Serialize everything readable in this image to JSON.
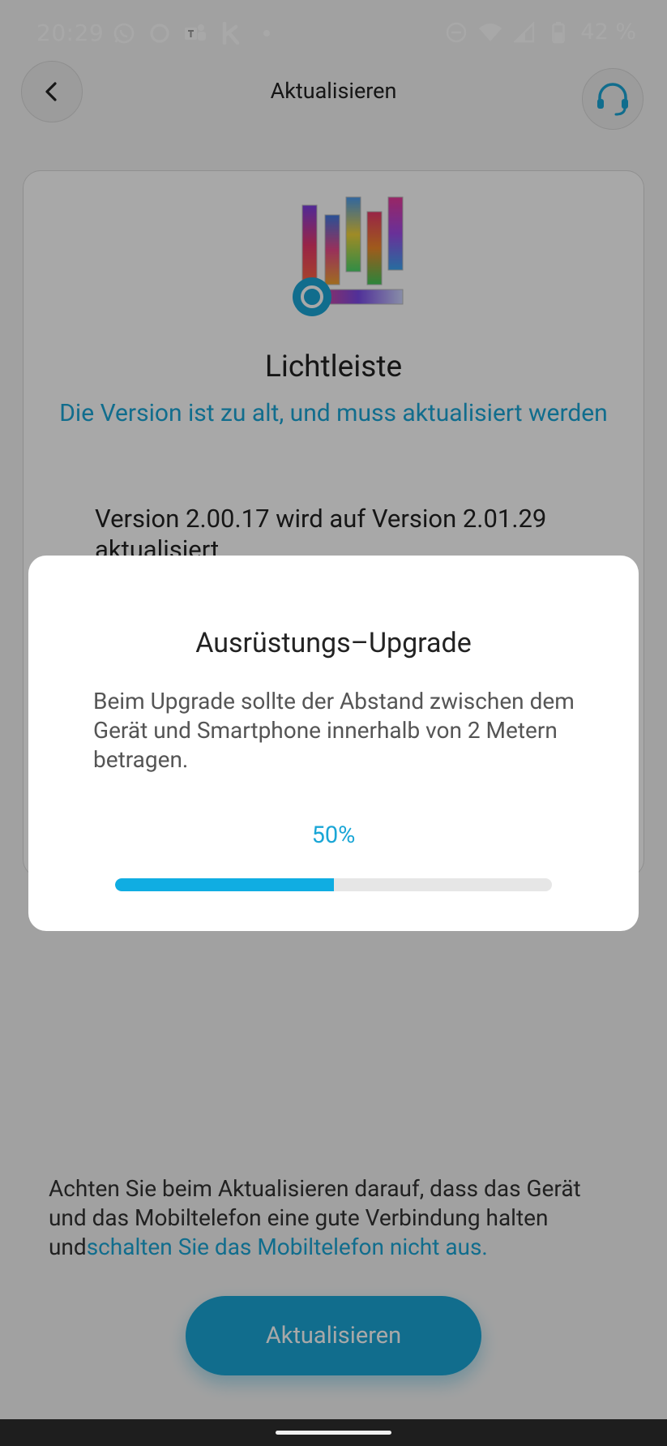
{
  "status_bar": {
    "time": "20:29",
    "battery": "42 %",
    "left_icons": [
      "whatsapp-icon",
      "circle-app-icon",
      "teams-icon",
      "k-app-icon",
      "dot-icon"
    ],
    "right_icons": [
      "do-not-disturb-icon",
      "wifi-icon",
      "signal-icon",
      "battery-icon"
    ]
  },
  "header": {
    "title": "Aktualisieren"
  },
  "card": {
    "device_name": "Lichtleiste",
    "warning": "Die Version ist zu alt, und muss aktualisiert werden",
    "version_info": "Version 2.00.17 wird auf Version 2.01.29 aktualisiert"
  },
  "bottom": {
    "note_plain": "Achten Sie beim Aktualisieren darauf, dass das Gerät und das Mobiltelefon eine gute Verbindung halten und",
    "note_highlight": "schalten Sie das Mobiltelefon nicht aus.",
    "update_button": "Aktualisieren"
  },
  "dialog": {
    "title": "Ausrüstungs–Upgrade",
    "message": "Beim Upgrade sollte der Abstand zwischen dem Gerät und Smartphone innerhalb von 2 Metern betragen.",
    "progress_label": "50%",
    "progress_value": 0.5
  },
  "colors": {
    "accent": "#1aa6d6",
    "progress_fill": "#10ade2",
    "overlay": "rgba(0,0,0,0.34)"
  }
}
